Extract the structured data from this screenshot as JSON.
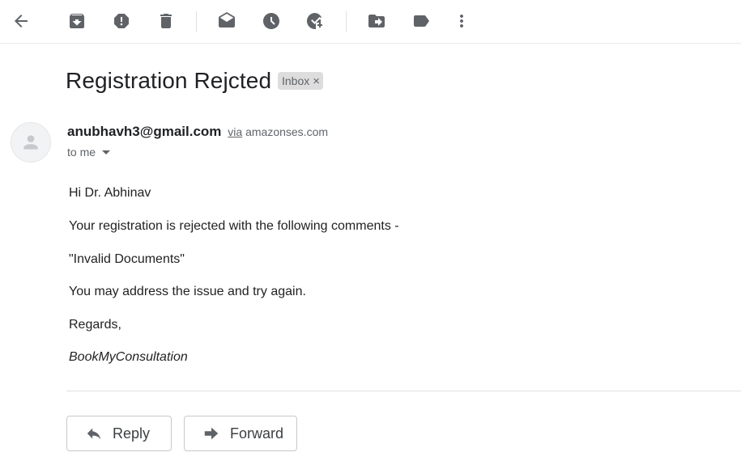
{
  "toolbar": {
    "icons": [
      "back-arrow-icon",
      "archive-icon",
      "report-spam-icon",
      "delete-icon",
      "mark-unread-icon",
      "snooze-icon",
      "add-to-tasks-icon",
      "move-to-icon",
      "label-icon",
      "more-options-icon"
    ]
  },
  "message": {
    "subject": "Registration Rejcted",
    "label": "Inbox",
    "label_remove": "×",
    "sender_email": "anubhavh3@gmail.com",
    "via_text": "via",
    "via_domain": "amazonses.com",
    "recipient": "to me"
  },
  "body": {
    "greeting": "Hi Dr. Abhinav",
    "line1": "Your registration is rejected with the following comments -",
    "comment": "\"Invalid Documents\"",
    "line2": "You may address the issue and try again.",
    "closing": "Regards,",
    "signature": "BookMyConsultation"
  },
  "actions": {
    "reply": "Reply",
    "forward": "Forward"
  },
  "colors": {
    "icon": "#5f6368",
    "chip_bg": "#dddddd",
    "text": "#202124"
  }
}
